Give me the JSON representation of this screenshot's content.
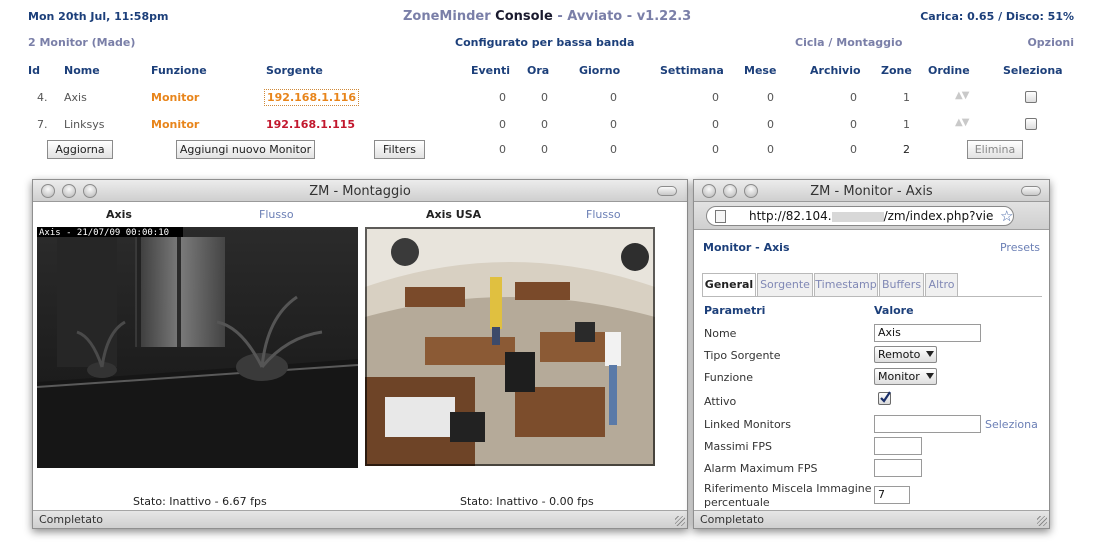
{
  "header": {
    "datetime": "Mon 20th Jul, 11:58pm",
    "app_name": "ZoneMinder",
    "console": "Console",
    "separator": "-",
    "state": "Avviato",
    "separator2": "-",
    "version": "v1.22.3",
    "load_disk": "Carica: 0.65 / Disco: 51%"
  },
  "subheader": {
    "monitor_count": "2 Monitor (Made)",
    "bandwidth": "Configurato per bassa banda",
    "cycle": "Cicla",
    "slash": "/",
    "montage": "Montaggio",
    "options": "Opzioni"
  },
  "table": {
    "columns": {
      "id": "Id",
      "name": "Nome",
      "function": "Funzione",
      "source": "Sorgente",
      "events": "Eventi",
      "hour": "Ora",
      "day": "Giorno",
      "week": "Settimana",
      "month": "Mese",
      "archive": "Archivio",
      "zones": "Zone",
      "order": "Ordine",
      "select": "Seleziona"
    },
    "rows": [
      {
        "id": "4.",
        "name": "Axis",
        "function": "Monitor",
        "source": "192.168.1.116",
        "events": "0",
        "hour": "0",
        "day": "0",
        "week": "0",
        "month": "0",
        "archive": "0",
        "zones": "1",
        "order_icon": "up-down-arrows"
      },
      {
        "id": "7.",
        "name": "Linksys",
        "function": "Monitor",
        "source": "192.168.1.115",
        "events": "0",
        "hour": "0",
        "day": "0",
        "week": "0",
        "month": "0",
        "archive": "0",
        "zones": "1",
        "order_icon": "up-down-arrows"
      }
    ],
    "totals": {
      "events": "0",
      "hour": "0",
      "day": "0",
      "week": "0",
      "month": "0",
      "archive": "0",
      "zones": "2"
    },
    "buttons": {
      "refresh": "Aggiorna",
      "add_monitor": "Aggiungi nuovo Monitor",
      "filters": "Filters",
      "delete": "Elimina"
    }
  },
  "montage_window": {
    "title": "ZM - Montaggio",
    "cam1": {
      "name": "Axis",
      "stream": "Flusso",
      "overlay": "Axis - 21/07/09 00:00:10",
      "status": "Stato: Inattivo - 6.67 fps"
    },
    "cam2": {
      "name": "Axis USA",
      "stream": "Flusso",
      "status": "Stato: Inattivo - 0.00 fps"
    },
    "statusbar": "Completato"
  },
  "monitor_window": {
    "title": "ZM - Monitor - Axis",
    "url": "http://82.104.",
    "url_rest": "/zm/index.php?vie",
    "heading": "Monitor - Axis",
    "presets": "Presets",
    "tabs": [
      "General",
      "Sorgente",
      "Timestamp",
      "Buffers",
      "Altro"
    ],
    "param_header": "Parametri",
    "value_header": "Valore",
    "fields": {
      "name_label": "Nome",
      "name_value": "Axis",
      "source_type_label": "Tipo Sorgente",
      "source_type_value": "Remoto",
      "function_label": "Funzione",
      "function_value": "Monitor",
      "active_label": "Attivo",
      "linked_label": "Linked Monitors",
      "linked_action": "Seleziona",
      "max_fps_label": "Massimi FPS",
      "alarm_fps_label": "Alarm Maximum FPS",
      "blend_label_1": "Riferimento Miscela Immagine",
      "blend_label_2": "percentuale",
      "blend_value": "7"
    },
    "statusbar": "Completato"
  },
  "colors": {
    "navy": "#1c3f7a",
    "orange": "#e8851b",
    "red": "#c2172d",
    "link": "#6b7fb5"
  }
}
